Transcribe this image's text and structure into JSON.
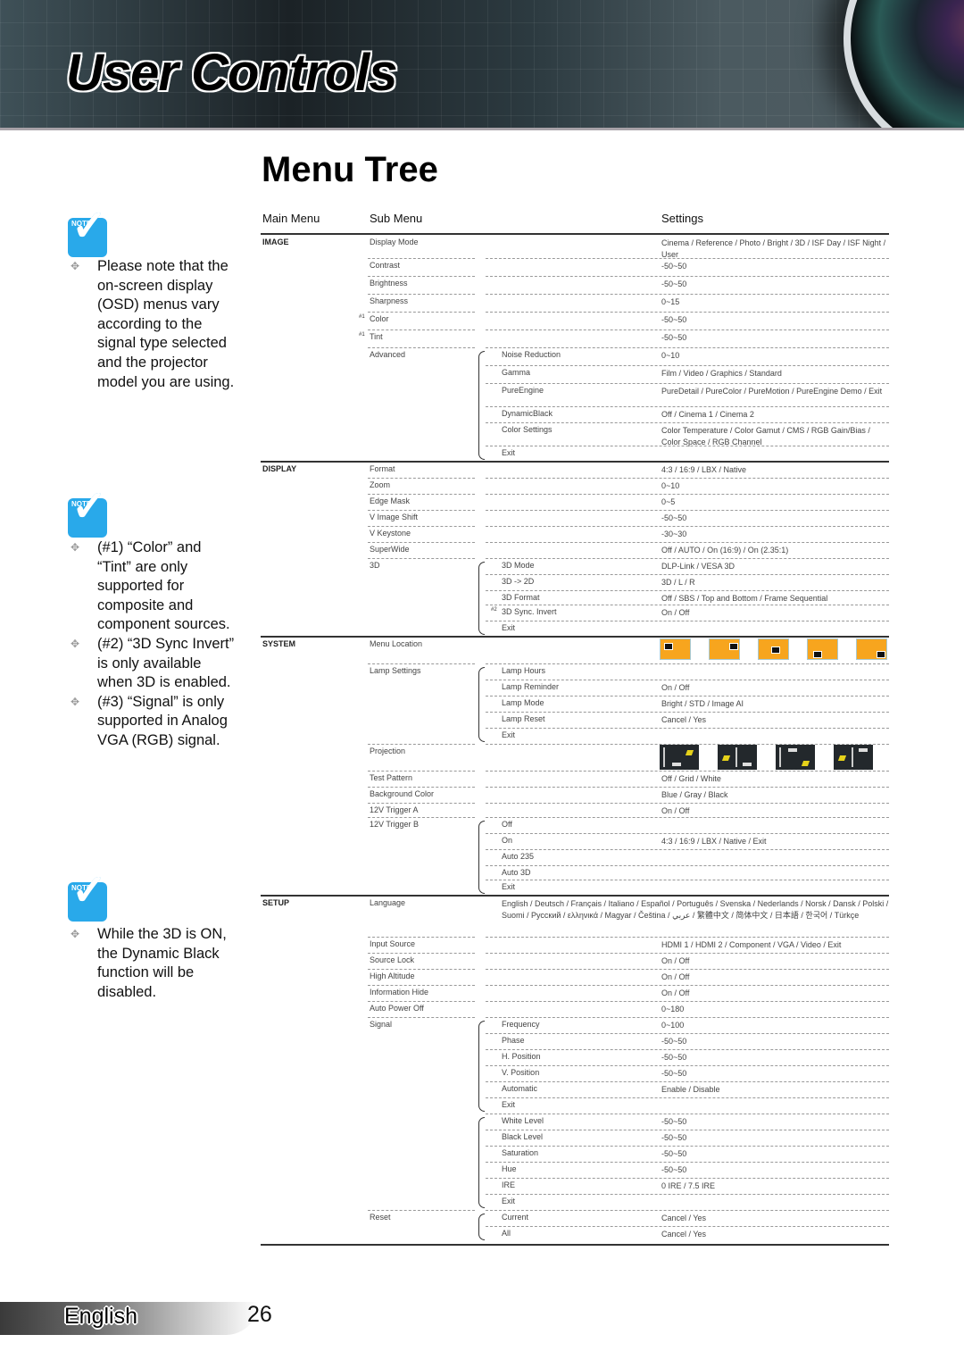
{
  "header": {
    "section_title": "User Controls"
  },
  "page_title": "Menu Tree",
  "columns": {
    "main": "Main Menu",
    "sub": "Sub Menu",
    "settings": "Settings"
  },
  "notes": [
    {
      "icon_label": "NOTE",
      "items": [
        "Please note that the on-screen display (OSD) menus vary according to the signal type selected and the projector model you are using."
      ]
    },
    {
      "icon_label": "NOTE",
      "items": [
        "(#1) “Color” and “Tint” are only supported for composite and component sources.",
        "(#2) “3D Sync Invert” is only available when 3D is enabled.",
        "(#3) “Signal” is only supported in Analog VGA (RGB) signal."
      ]
    },
    {
      "icon_label": "NOTE",
      "items": [
        "While the 3D is ON, the Dynamic Black function will be disabled."
      ]
    }
  ],
  "rows": [
    {
      "main": "IMAGE",
      "sub": "Display Mode",
      "sub2": "",
      "settings": "Cinema / Reference / Photo / Bright / 3D / ISF Day / ISF Night / User"
    },
    {
      "main": "",
      "sub": "Contrast",
      "sub2": "",
      "settings": "-50~50"
    },
    {
      "main": "",
      "sub": "Brightness",
      "sub2": "",
      "settings": "-50~50"
    },
    {
      "main": "",
      "sub": "Sharpness",
      "sub2": "",
      "settings": "0~15"
    },
    {
      "main": "",
      "mark": "#1",
      "sub": "Color",
      "sub2": "",
      "settings": "-50~50"
    },
    {
      "main": "",
      "mark": "#1",
      "sub": "Tint",
      "sub2": "",
      "settings": "-50~50"
    },
    {
      "main": "",
      "sub": "Advanced",
      "sub2": "Noise Reduction",
      "settings": "0~10"
    },
    {
      "main": "",
      "sub": "",
      "sub2": "Gamma",
      "settings": "Film / Video / Graphics / Standard"
    },
    {
      "main": "",
      "sub": "",
      "sub2": "PureEngine",
      "settings": "PureDetail / PureColor / PureMotion / PureEngine Demo / Exit"
    },
    {
      "main": "",
      "sub": "",
      "sub2": "DynamicBlack",
      "settings": "Off / Cinema 1 / Cinema 2"
    },
    {
      "main": "",
      "sub": "",
      "sub2": "Color Settings",
      "settings": "Color Temperature / Color Gamut / CMS / RGB Gain/Bias / Color Space / RGB Channel"
    },
    {
      "main": "",
      "sub": "",
      "sub2": "Exit",
      "settings": ""
    },
    {
      "main": "DISPLAY",
      "sub": "Format",
      "sub2": "",
      "settings": "4:3 / 16:9 / LBX / Native"
    },
    {
      "main": "",
      "sub": "Zoom",
      "sub2": "",
      "settings": "0~10"
    },
    {
      "main": "",
      "sub": "Edge Mask",
      "sub2": "",
      "settings": "0~5"
    },
    {
      "main": "",
      "sub": "V Image Shift",
      "sub2": "",
      "settings": "-50~50"
    },
    {
      "main": "",
      "sub": "V Keystone",
      "sub2": "",
      "settings": "-30~30"
    },
    {
      "main": "",
      "sub": "SuperWide",
      "sub2": "",
      "settings": "Off / AUTO / On (16:9) / On (2.35:1)"
    },
    {
      "main": "",
      "sub": "3D",
      "sub2": "3D Mode",
      "settings": "DLP-Link / VESA 3D"
    },
    {
      "main": "",
      "sub": "",
      "sub2": "3D -> 2D",
      "settings": "3D / L / R"
    },
    {
      "main": "",
      "sub": "",
      "sub2": "3D Format",
      "settings": "Off / SBS / Top and Bottom / Frame Sequential"
    },
    {
      "main": "",
      "sub": "",
      "mark2": "#2",
      "sub2": "3D Sync. Invert",
      "settings": "On / Off"
    },
    {
      "main": "",
      "sub": "",
      "sub2": "Exit",
      "settings": ""
    },
    {
      "main": "SYSTEM",
      "sub": "Menu Location",
      "sub2": "",
      "settings": "",
      "icons": "menu-location"
    },
    {
      "main": "",
      "sub": "Lamp Settings",
      "sub2": "Lamp Hours",
      "settings": ""
    },
    {
      "main": "",
      "sub": "",
      "sub2": "Lamp Reminder",
      "settings": "On / Off"
    },
    {
      "main": "",
      "sub": "",
      "sub2": "Lamp Mode",
      "settings": "Bright / STD / Image AI"
    },
    {
      "main": "",
      "sub": "",
      "sub2": "Lamp Reset",
      "settings": "Cancel / Yes"
    },
    {
      "main": "",
      "sub": "",
      "sub2": "Exit",
      "settings": ""
    },
    {
      "main": "",
      "sub": "Projection",
      "sub2": "",
      "settings": "",
      "icons": "projection"
    },
    {
      "main": "",
      "sub": "Test Pattern",
      "sub2": "",
      "settings": "Off / Grid / White"
    },
    {
      "main": "",
      "sub": "Background Color",
      "sub2": "",
      "settings": "Blue / Gray / Black"
    },
    {
      "main": "",
      "sub": "12V Trigger A",
      "sub2": "",
      "settings": "On / Off"
    },
    {
      "main": "",
      "sub": "12V Trigger B",
      "sub2": "Off",
      "settings": ""
    },
    {
      "main": "",
      "sub": "",
      "sub2": "On",
      "settings": "4:3 / 16:9 / LBX / Native / Exit"
    },
    {
      "main": "",
      "sub": "",
      "sub2": "Auto 235",
      "settings": ""
    },
    {
      "main": "",
      "sub": "",
      "sub2": "Auto 3D",
      "settings": ""
    },
    {
      "main": "",
      "sub": "",
      "sub2": "Exit",
      "settings": ""
    },
    {
      "main": "SETUP",
      "sub": "Language",
      "sub2": "",
      "settings": "English / Deutsch / Français / Italiano / Español / Português / Svenska / Nederlands / Norsk / Dansk / Polski / Suomi / Русский / ελληνικά / Magyar / Čeština / عربي / 繁體中文 / 简体中文 / 日本語 / 한국어 / Türkçe"
    },
    {
      "main": "",
      "sub": "Input Source",
      "sub2": "",
      "settings": "HDMI 1 / HDMI 2 / Component / VGA / Video / Exit"
    },
    {
      "main": "",
      "sub": "Source Lock",
      "sub2": "",
      "settings": "On / Off"
    },
    {
      "main": "",
      "sub": "High Altitude",
      "sub2": "",
      "settings": "On / Off"
    },
    {
      "main": "",
      "sub": "Information Hide",
      "sub2": "",
      "settings": "On / Off"
    },
    {
      "main": "",
      "sub": "Auto Power Off",
      "sub2": "",
      "settings": "0~180"
    },
    {
      "main": "",
      "sub": "Signal",
      "sub2": "Frequency",
      "settings": "0~100"
    },
    {
      "main": "",
      "sub": "",
      "sub2": "Phase",
      "settings": "-50~50"
    },
    {
      "main": "",
      "sub": "",
      "sub2": "H. Position",
      "settings": "-50~50"
    },
    {
      "main": "",
      "sub": "",
      "sub2": "V. Position",
      "settings": "-50~50"
    },
    {
      "main": "",
      "sub": "",
      "sub2": "Automatic",
      "settings": "Enable / Disable"
    },
    {
      "main": "",
      "sub": "",
      "sub2": "Exit",
      "settings": ""
    },
    {
      "main": "",
      "sub": "",
      "sub2": "White Level",
      "settings": "-50~50"
    },
    {
      "main": "",
      "sub": "",
      "sub2": "Black Level",
      "settings": "-50~50"
    },
    {
      "main": "",
      "sub": "",
      "sub2": "Saturation",
      "settings": "-50~50"
    },
    {
      "main": "",
      "sub": "",
      "sub2": "Hue",
      "settings": "-50~50"
    },
    {
      "main": "",
      "sub": "",
      "sub2": "IRE",
      "settings": "0 IRE / 7.5 IRE"
    },
    {
      "main": "",
      "sub": "",
      "sub2": "Exit",
      "settings": ""
    },
    {
      "main": "",
      "sub": "Reset",
      "sub2": "Current",
      "settings": "Cancel / Yes"
    },
    {
      "main": "",
      "sub": "",
      "sub2": "All",
      "settings": "Cancel / Yes"
    }
  ],
  "footer": {
    "language": "English",
    "page_number": "26"
  }
}
